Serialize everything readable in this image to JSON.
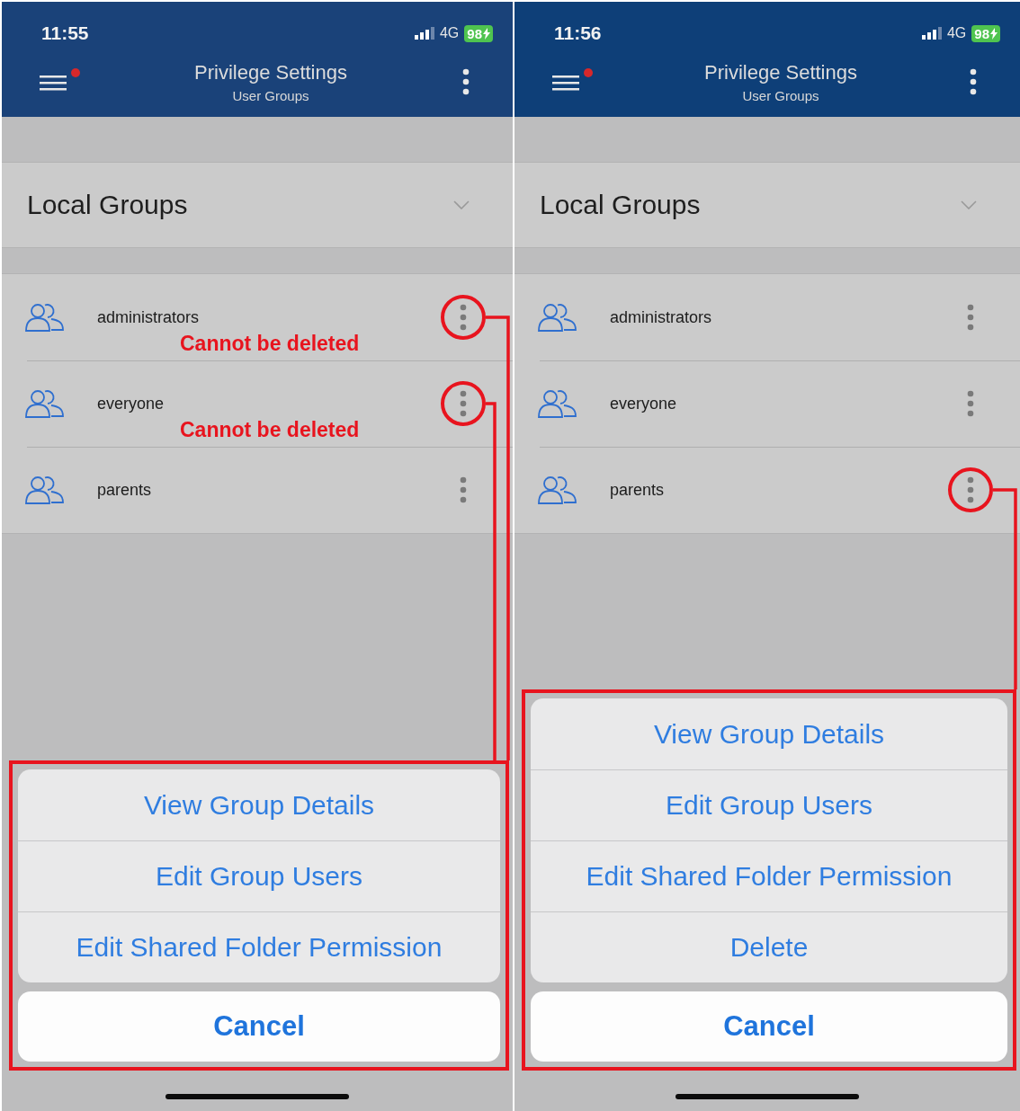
{
  "screens": [
    {
      "status_bar": {
        "time": "11:55",
        "network": "4G",
        "battery": "98"
      },
      "header": {
        "title": "Privilege Settings",
        "subtitle": "User Groups",
        "notification": true
      },
      "dropdown": {
        "label": "Local Groups",
        "expanded": false
      },
      "groups": [
        {
          "name": "administrators",
          "highlighted": true,
          "note": "Cannot be deleted"
        },
        {
          "name": "everyone",
          "highlighted": true,
          "note": "Cannot be deleted"
        },
        {
          "name": "parents",
          "highlighted": false
        }
      ],
      "action_sheet": {
        "highlighted": true,
        "actions": [
          "View Group Details",
          "Edit Group Users",
          "Edit Shared Folder Permission"
        ],
        "cancel": "Cancel"
      }
    },
    {
      "status_bar": {
        "time": "11:56",
        "network": "4G",
        "battery": "98"
      },
      "header": {
        "title": "Privilege Settings",
        "subtitle": "User Groups",
        "notification": true
      },
      "dropdown": {
        "label": "Local Groups",
        "expanded": false
      },
      "groups": [
        {
          "name": "administrators",
          "highlighted": false
        },
        {
          "name": "everyone",
          "highlighted": false
        },
        {
          "name": "parents",
          "highlighted": true
        }
      ],
      "action_sheet": {
        "highlighted": true,
        "actions": [
          "View Group Details",
          "Edit Group Users",
          "Edit Shared Folder Permission",
          "Delete"
        ],
        "cancel": "Cancel"
      }
    }
  ]
}
